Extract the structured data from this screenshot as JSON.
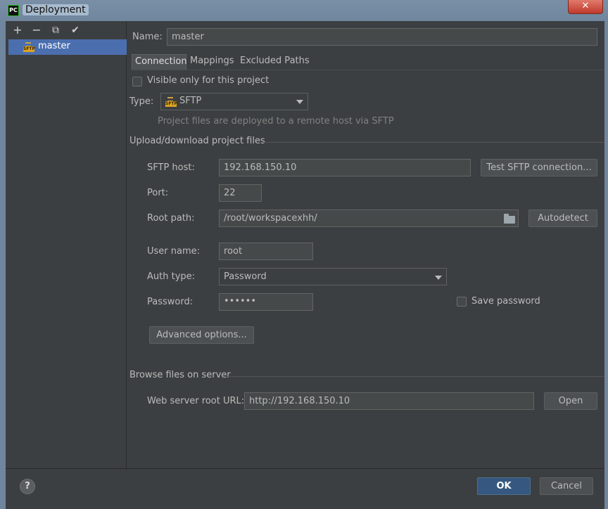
{
  "window": {
    "title": "Deployment",
    "app_icon_text": "PC",
    "close_glyph": "✕"
  },
  "toolbar": {
    "add_glyph": "+",
    "remove_glyph": "−",
    "copy_glyph": "⧉",
    "check_glyph": "✔"
  },
  "tree": {
    "items": [
      {
        "label": "master",
        "icon": "sftp-icon",
        "icon_text": "SFTP",
        "selected": true
      }
    ]
  },
  "name": {
    "label": "Name:",
    "value": "master"
  },
  "tabs": [
    {
      "label": "Connection",
      "active": true
    },
    {
      "label": "Mappings",
      "active": false
    },
    {
      "label": "Excluded Paths",
      "active": false
    }
  ],
  "visible_only": {
    "label": "Visible only for this project",
    "checked": false
  },
  "type": {
    "label": "Type:",
    "value": "SFTP",
    "icon_text": "SFTP",
    "hint": "Project files are deployed to a remote host via SFTP"
  },
  "upload_section": {
    "title": "Upload/download project files"
  },
  "sftp_host": {
    "label": "SFTP host:",
    "value": "192.168.150.10",
    "test_button": "Test SFTP connection..."
  },
  "port": {
    "label": "Port:",
    "value": "22"
  },
  "root_path": {
    "label": "Root path:",
    "value": "/root/workspacexhh/",
    "autodetect_button": "Autodetect"
  },
  "user_name": {
    "label": "User name:",
    "value": "root"
  },
  "auth_type": {
    "label": "Auth type:",
    "value": "Password"
  },
  "password": {
    "label": "Password:",
    "value": "••••••",
    "save_label": "Save password",
    "save_checked": false
  },
  "advanced_button": "Advanced options...",
  "browse_section": {
    "title": "Browse files on server"
  },
  "web_root": {
    "label": "Web server root URL:",
    "value": "http://192.168.150.10",
    "open_button": "Open"
  },
  "footer": {
    "help_glyph": "?",
    "ok": "OK",
    "cancel": "Cancel"
  },
  "colors": {
    "background": "#3c3f41",
    "selection": "#4b6eaf",
    "primary_button": "#365880",
    "field": "#45494a",
    "text": "#bbbbbb"
  }
}
